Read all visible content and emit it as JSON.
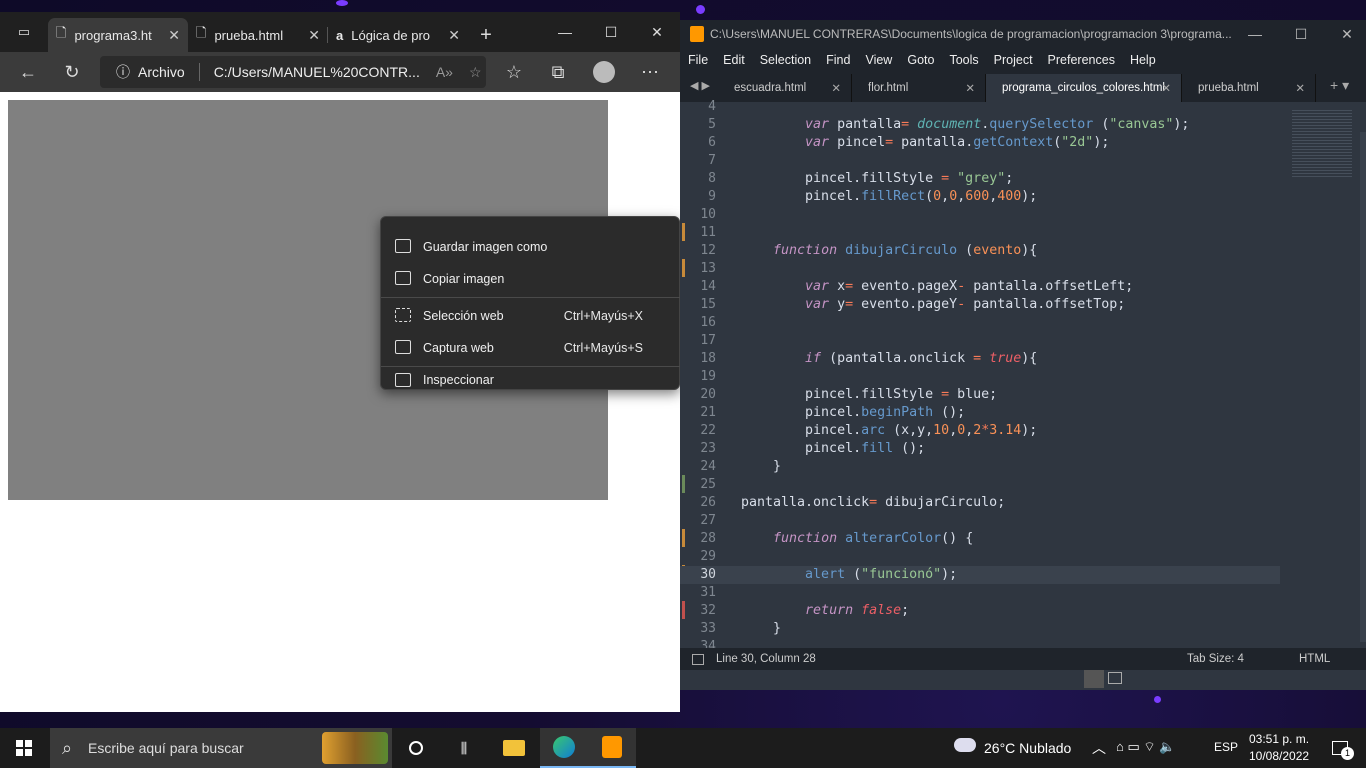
{
  "browser": {
    "tabs": [
      {
        "label": "programa3.ht",
        "active": true
      },
      {
        "label": "prueba.html",
        "active": false
      },
      {
        "label": "Lógica de pro",
        "active": false
      }
    ],
    "address_label": "Archivo",
    "address_url": "C:/Users/MANUEL%20CONTR..."
  },
  "context_menu": [
    {
      "label": "Guardar imagen como",
      "shortcut": ""
    },
    {
      "label": "Copiar imagen",
      "shortcut": ""
    },
    {
      "label": "Selección web",
      "shortcut": "Ctrl+Mayús+X"
    },
    {
      "label": "Captura web",
      "shortcut": "Ctrl+Mayús+S"
    },
    {
      "label": "Inspeccionar",
      "shortcut": ""
    }
  ],
  "editor": {
    "title": "C:\\Users\\MANUEL CONTRERAS\\Documents\\logica de programacion\\programacion 3\\programa...",
    "menu": [
      "File",
      "Edit",
      "Selection",
      "Find",
      "View",
      "Goto",
      "Tools",
      "Project",
      "Preferences",
      "Help"
    ],
    "tabs": [
      "escuadra.html",
      "flor.html",
      "programa_circulos_colores.html",
      "prueba.html"
    ],
    "active_tab": "programa_circulos_colores.html",
    "line_numbers": [
      "4",
      "5",
      "6",
      "7",
      "8",
      "9",
      "10",
      "11",
      "12",
      "13",
      "14",
      "15",
      "16",
      "17",
      "18",
      "19",
      "20",
      "21",
      "22",
      "23",
      "24",
      "25",
      "26",
      "27",
      "28",
      "29",
      "30",
      "31",
      "32",
      "33",
      "34"
    ],
    "current_line": "30",
    "status_position": "Line 30, Column 28",
    "status_tab_size": "Tab Size: 4",
    "status_syntax": "HTML"
  },
  "taskbar": {
    "search_placeholder": "Escribe aquí para buscar",
    "weather": "26°C  Nublado",
    "language": "ESP",
    "time": "03:51 p. m.",
    "date": "10/08/2022",
    "notifications": "1"
  },
  "colors": {
    "canvas": "#808080",
    "editor_bg": "#2f3640",
    "accent_orange": "#ff9800"
  }
}
